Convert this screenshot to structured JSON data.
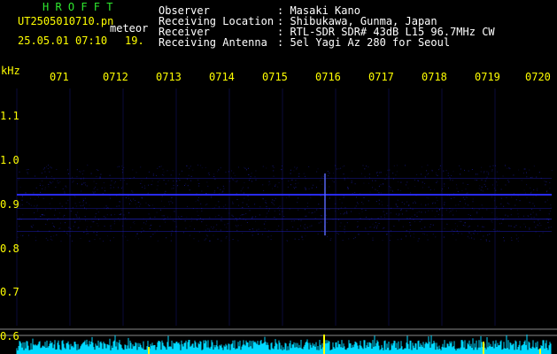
{
  "header": {
    "app_title": "H R O F F T",
    "filename": "UT2505010710.pn",
    "meteor_label": "meteor",
    "datetime": "25.05.01 07:10",
    "count": "19."
  },
  "info": {
    "labels": [
      "Observer",
      "Receiving Location",
      "Receiver",
      "Receiving Antenna"
    ],
    "values": [
      ": Masaki Kano",
      ": Shibukawa, Gunma, Japan",
      ": RTL-SDR SDR# 43dB L15 96.7MHz CW",
      ": 5el Yagi Az 280 for Seoul"
    ]
  },
  "axis": {
    "y_unit": "kHz",
    "y_ticks": [
      "1.1",
      "1.0",
      "0.9",
      "0.8",
      "0.7",
      "0.6"
    ],
    "x_ticks": [
      "071",
      "0712",
      "0713",
      "0714",
      "0715",
      "0716",
      "0717",
      "0718",
      "0719",
      "0720"
    ]
  },
  "colors": {
    "background": "#000000",
    "text_yellow": "#ffff00",
    "text_white": "#ffffff",
    "title_green": "#2ee82e",
    "signal_blue": "#2a2cff",
    "noise_cyan": "#00d8ff"
  }
}
